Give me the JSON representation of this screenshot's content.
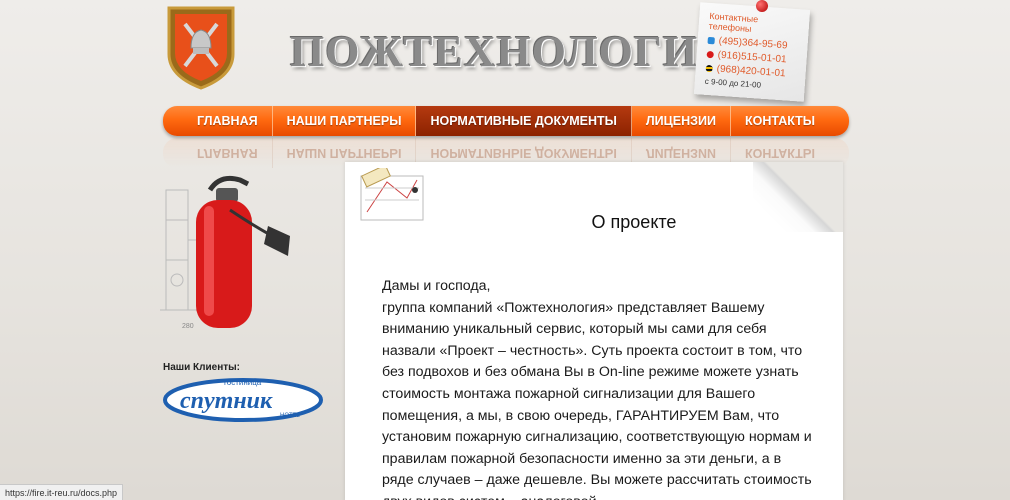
{
  "header": {
    "site_title": "ПОЖТЕХНОЛОГИЯ",
    "contacts": {
      "title": "Контактные телефоны",
      "phones": [
        "(495)364-95-69",
        "(916)515-01-01",
        "(968)420-01-01"
      ],
      "hours": "с 9-00 до 21-00"
    }
  },
  "nav": {
    "items": [
      "ГЛАВНАЯ",
      "НАШИ ПАРТНЕРЫ",
      "НОРМАТИВНЫЕ ДОКУМЕНТЫ",
      "ЛИЦЕНЗИИ",
      "КОНТАКТЫ"
    ],
    "active_index": 2
  },
  "sidebar": {
    "clients_label": "Наши Клиенты:",
    "client_logo_text": {
      "top": "гостиница",
      "main": "спутник",
      "bottom": "HOTEL"
    },
    "drawing_label": "280"
  },
  "content": {
    "title": "О проекте",
    "paragraph": "Дамы и господа,\nгруппа компаний «Пожтехнология» представляет Вашему вниманию уникальный сервис, который мы сами для себя назвали «Проект – честность». Суть проекта состоит в том, что без подвохов и без обмана Вы в On-line режиме можете узнать стоимость монтажа пожарной сигнализации для Вашего помещения, а мы, в свою очередь, ГАРАНТИРУЕМ Вам, что установим пожарную сигнализацию, соответствующую нормам и правилам пожарной безопасности именно за эти деньги, а в ряде случаев – даже дешевле. Вы можете рассчитать стоимость двух видов систем – аналоговой"
  },
  "status_bar": {
    "url": "https://fire.it-reu.ru/docs.php"
  },
  "colors": {
    "accent": "#ff6a10",
    "active": "#8c2200",
    "phone": "#e05a2a"
  }
}
